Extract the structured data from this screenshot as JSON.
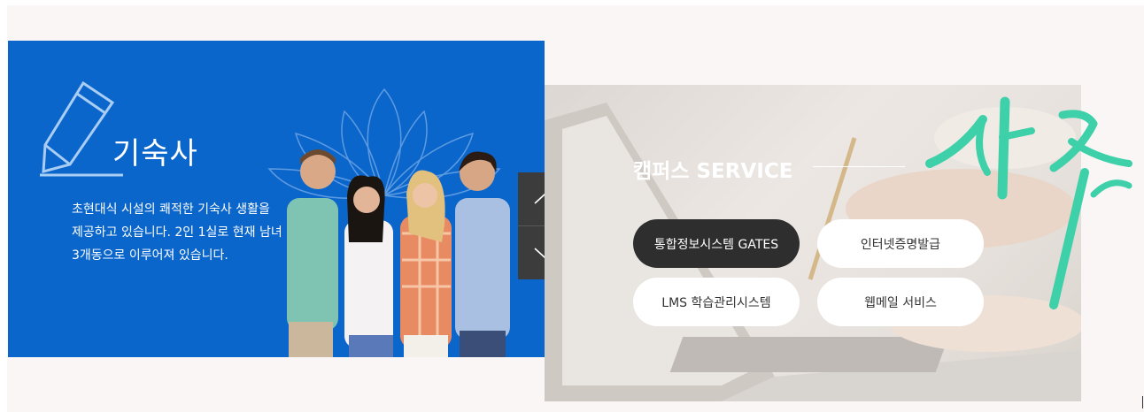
{
  "dormitory": {
    "title": "기숙사",
    "description_lines": [
      "초현대식 시설의 쾌적한 기숙사 생활을",
      "제공하고 있습니다. 2인 1실로 현재 남녀",
      "3개동으로 이루어져 있습니다."
    ]
  },
  "controls": {
    "up_icon": "chevron-up-icon",
    "down_icon": "chevron-down-icon"
  },
  "campus_service": {
    "title": "캠퍼스 SERVICE",
    "buttons": [
      {
        "label": "통합정보시스템 GATES",
        "active": true
      },
      {
        "label": "인터넷증명발급",
        "active": false
      },
      {
        "label": "LMS 학습관리시스템",
        "active": false
      },
      {
        "label": "웹메일 서비스",
        "active": false
      }
    ]
  },
  "colors": {
    "dorm_blue": "#0b66cc",
    "dark_button": "#2e2e2e",
    "brush_green": "#3ed0a8"
  }
}
